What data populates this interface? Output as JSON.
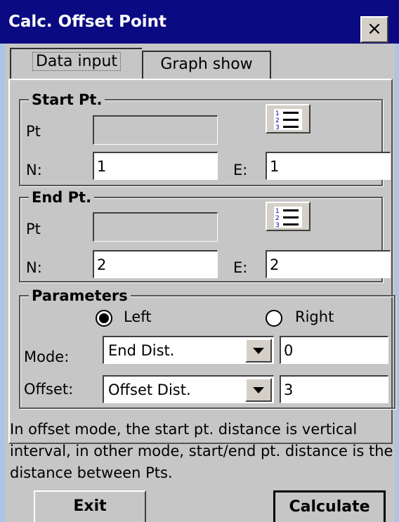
{
  "window": {
    "title": "Calc. Offset Point",
    "close_label": "×"
  },
  "tabs": [
    {
      "label": "Data input",
      "active": true
    },
    {
      "label": "Graph show",
      "active": false
    }
  ],
  "start_pt": {
    "group_title": "Start Pt.",
    "pt_label": "Pt",
    "pt_value": "",
    "n_label": "N:",
    "n_value": "1",
    "e_label": "E:",
    "e_value": "1"
  },
  "end_pt": {
    "group_title": "End Pt.",
    "pt_label": "Pt",
    "pt_value": "",
    "n_label": "N:",
    "n_value": "2",
    "e_label": "E:",
    "e_value": "2"
  },
  "parameters": {
    "group_title": "Parameters",
    "left_label": "Left",
    "right_label": "Right",
    "selected_side": "Left",
    "mode_label": "Mode:",
    "mode_value": "End Dist.",
    "mode_number": "0",
    "offset_label": "Offset:",
    "offset_value": "Offset Dist.",
    "offset_number": "3"
  },
  "note": "In offset mode, the start pt. distance is vertical interval, in other mode, start/end pt. distance is the distance between Pts.",
  "buttons": {
    "exit_label": "Exit",
    "calculate_label": "Calculate"
  },
  "colors": {
    "titlebar": "#0a0a82",
    "window_bg": "#c7c6c7",
    "desktop": "#a9c6e9"
  }
}
